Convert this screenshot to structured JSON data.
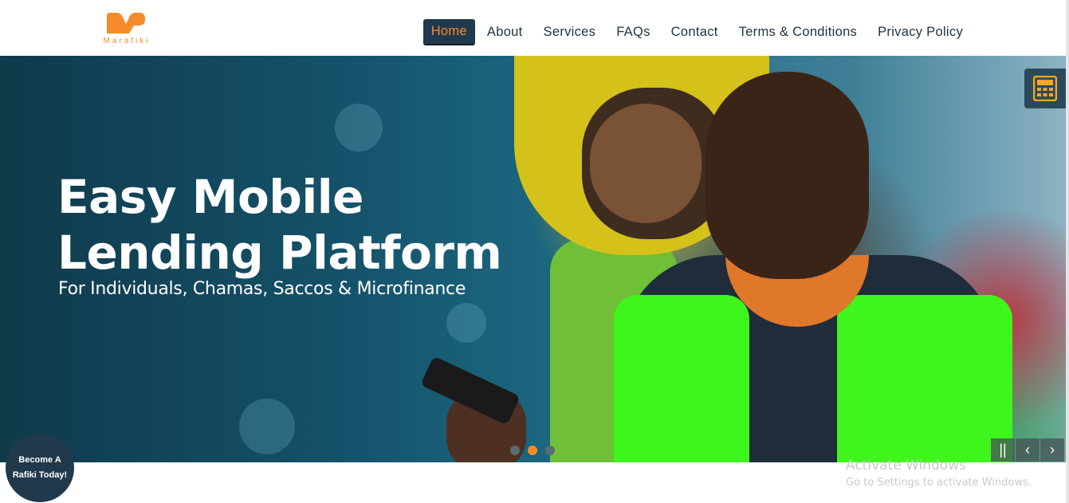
{
  "brand": {
    "name": "Marafiki",
    "color": "#f58b2a"
  },
  "nav": {
    "items": [
      {
        "label": "Home",
        "active": true
      },
      {
        "label": "About"
      },
      {
        "label": "Services"
      },
      {
        "label": "FAQs"
      },
      {
        "label": "Contact"
      },
      {
        "label": "Terms & Conditions"
      },
      {
        "label": "Privacy Policy"
      }
    ]
  },
  "hero": {
    "title": "Easy Mobile Lending Platform",
    "subtitle": "For Individuals, Chamas, Saccos & Microfinance",
    "slides": {
      "count": 3,
      "active_index": 1
    },
    "controls": {
      "pause_icon": "||",
      "prev_icon": "‹",
      "next_icon": "›"
    }
  },
  "calculator": {
    "icon": "calculator-icon"
  },
  "cta": {
    "label": "Become A Rafiki Today!"
  },
  "watermark": {
    "title": "Activate Windows",
    "subtitle": "Go to Settings to activate Windows."
  },
  "colors": {
    "accent": "#f58b2a",
    "navy": "#21394c"
  }
}
